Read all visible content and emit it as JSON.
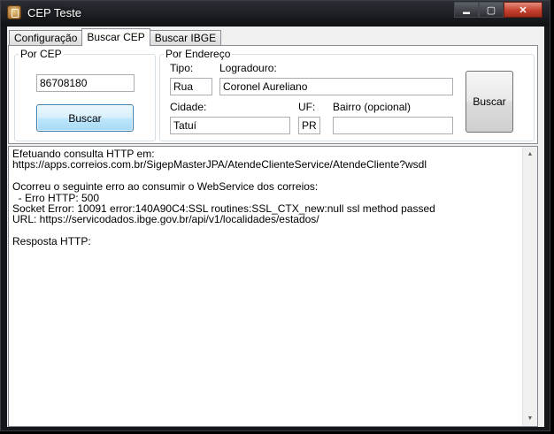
{
  "window": {
    "title": "CEP Teste",
    "icon": "app-icon",
    "caption_buttons": [
      "minimize-icon",
      "maximize-icon",
      "close-icon"
    ]
  },
  "tabs": [
    {
      "label": "Configuração",
      "active": false
    },
    {
      "label": "Buscar CEP",
      "active": true
    },
    {
      "label": "Buscar IBGE",
      "active": false
    }
  ],
  "por_cep": {
    "legend": "Por CEP",
    "cep_value": "86708180",
    "search_label": "Buscar"
  },
  "por_endereco": {
    "legend": "Por Endereço",
    "tipo_label": "Tipo:",
    "tipo_value": "Rua",
    "logradouro_label": "Logradouro:",
    "logradouro_value": "Coronel Aureliano",
    "cidade_label": "Cidade:",
    "cidade_value": "Tatuí",
    "uf_label": "UF:",
    "uf_value": "PR",
    "bairro_label": "Bairro (opcional)",
    "bairro_value": "",
    "search_label": "Buscar"
  },
  "output": {
    "text": "Efetuando consulta HTTP em:\nhttps://apps.correios.com.br/SigepMasterJPA/AtendeClienteService/AtendeCliente?wsdl\n\nOcorreu o seguinte erro ao consumir o WebService dos correios:\n  - Erro HTTP: 500\nSocket Error: 10091 error:140A90C4:SSL routines:SSL_CTX_new:null ssl method passed\nURL: https://servicodados.ibge.gov.br/api/v1/localidades/estados/\n\nResposta HTTP:"
  },
  "icons": {
    "scroll_up": "▲",
    "scroll_down": "▼",
    "minimize": "▬",
    "maximize": "▢",
    "close": "✕"
  }
}
